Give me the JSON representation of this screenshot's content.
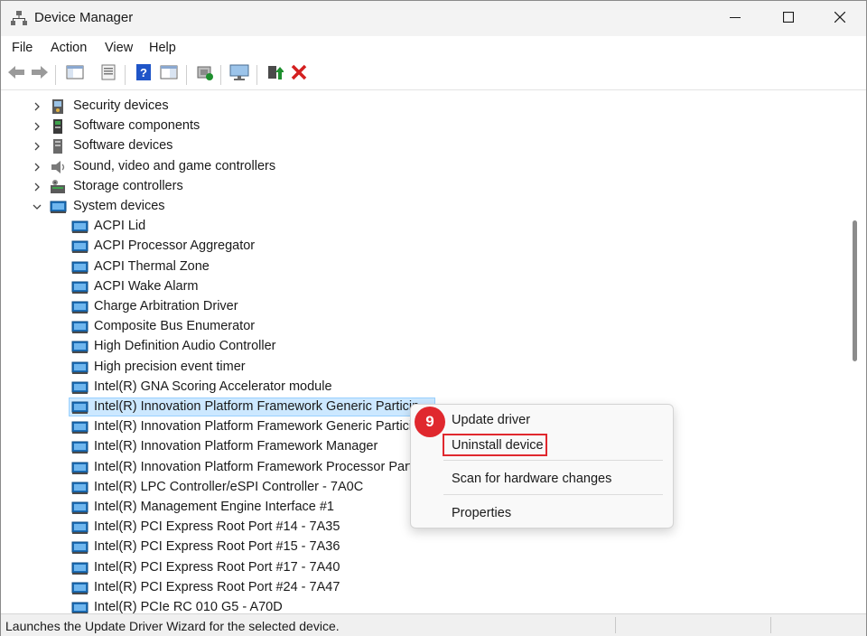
{
  "window": {
    "title": "Device Manager"
  },
  "menu": [
    "File",
    "Action",
    "View",
    "Help"
  ],
  "toolbar": {
    "icons": [
      "back-arrow-icon",
      "forward-arrow-icon",
      "show-hide-tree-icon",
      "properties-icon",
      "help-icon",
      "view-icon",
      "scan-hardware-icon",
      "monitor-icon",
      "update-driver-icon",
      "uninstall-x-icon"
    ],
    "accent_colors": {
      "uninstall": "#d42020",
      "update": "#1e8f2e",
      "help": "#1f55c8"
    }
  },
  "tree": {
    "categories": [
      {
        "label": "Security devices",
        "icon": "security-device-icon",
        "expanded": false
      },
      {
        "label": "Software components",
        "icon": "software-component-icon",
        "expanded": false
      },
      {
        "label": "Software devices",
        "icon": "software-device-icon",
        "expanded": false
      },
      {
        "label": "Sound, video and game controllers",
        "icon": "speaker-icon",
        "expanded": false
      },
      {
        "label": "Storage controllers",
        "icon": "storage-controller-icon",
        "expanded": false
      },
      {
        "label": "System devices",
        "icon": "system-device-icon",
        "expanded": true
      }
    ],
    "children": [
      {
        "label": "ACPI Lid"
      },
      {
        "label": "ACPI Processor Aggregator"
      },
      {
        "label": "ACPI Thermal Zone"
      },
      {
        "label": "ACPI Wake Alarm"
      },
      {
        "label": "Charge Arbitration Driver"
      },
      {
        "label": "Composite Bus Enumerator"
      },
      {
        "label": "High Definition Audio Controller"
      },
      {
        "label": "High precision event timer"
      },
      {
        "label": "Intel(R) GNA Scoring Accelerator module"
      },
      {
        "label": "Intel(R) Innovation Platform Framework Generic Particip",
        "selected": true
      },
      {
        "label": "Intel(R) Innovation Platform Framework Generic Particip"
      },
      {
        "label": "Intel(R) Innovation Platform Framework Manager"
      },
      {
        "label": "Intel(R) Innovation Platform Framework Processor Partic"
      },
      {
        "label": "Intel(R) LPC Controller/eSPI Controller - 7A0C"
      },
      {
        "label": "Intel(R) Management Engine Interface #1"
      },
      {
        "label": "Intel(R) PCI Express Root Port #14 - 7A35"
      },
      {
        "label": "Intel(R) PCI Express Root Port #15 - 7A36"
      },
      {
        "label": "Intel(R) PCI Express Root Port #17 - 7A40"
      },
      {
        "label": "Intel(R) PCI Express Root Port #24 - 7A47"
      },
      {
        "label": "Intel(R) PCIe RC 010 G5 - A70D"
      }
    ]
  },
  "context_menu": {
    "items": [
      "Update driver",
      "Uninstall device",
      "Scan for hardware changes",
      "Properties"
    ],
    "highlighted": "Uninstall device",
    "step_badge": "9",
    "highlight_color": "#e0282e"
  },
  "status": {
    "text": "Launches the Update Driver Wizard for the selected device."
  }
}
